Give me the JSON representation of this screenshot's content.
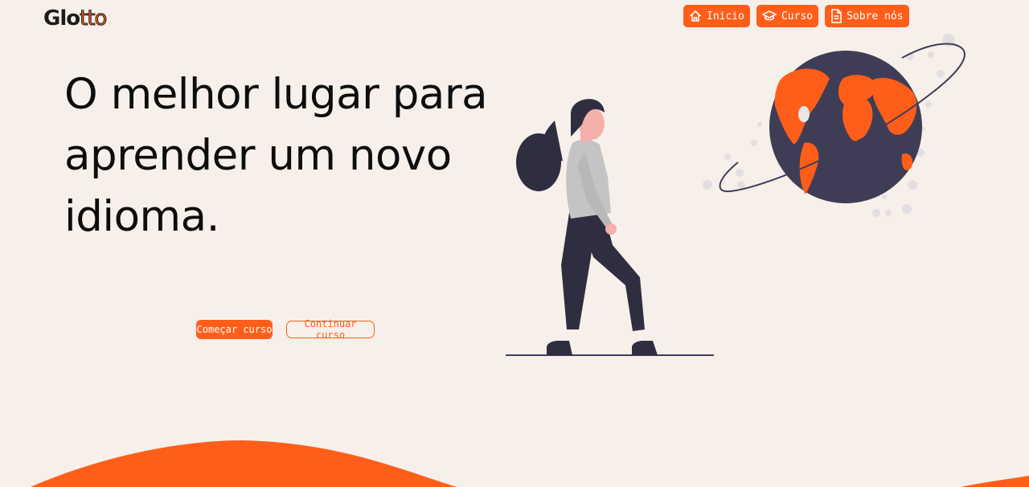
{
  "header": {
    "logo_part1": "Glo",
    "logo_part2": "tto",
    "nav": [
      {
        "label": "Inicio",
        "icon": "home-icon"
      },
      {
        "label": "Curso",
        "icon": "graduation-cap-icon"
      },
      {
        "label": "Sobre nós",
        "icon": "document-icon"
      }
    ]
  },
  "hero": {
    "title": "O melhor lugar para aprender um novo idioma.",
    "primary_button": "Começar curso",
    "secondary_button": "Continuar curso"
  },
  "colors": {
    "accent": "#ff5e1a",
    "background": "#f7f0ea",
    "dark": "#2f2e41",
    "text": "#0d0d0d"
  }
}
